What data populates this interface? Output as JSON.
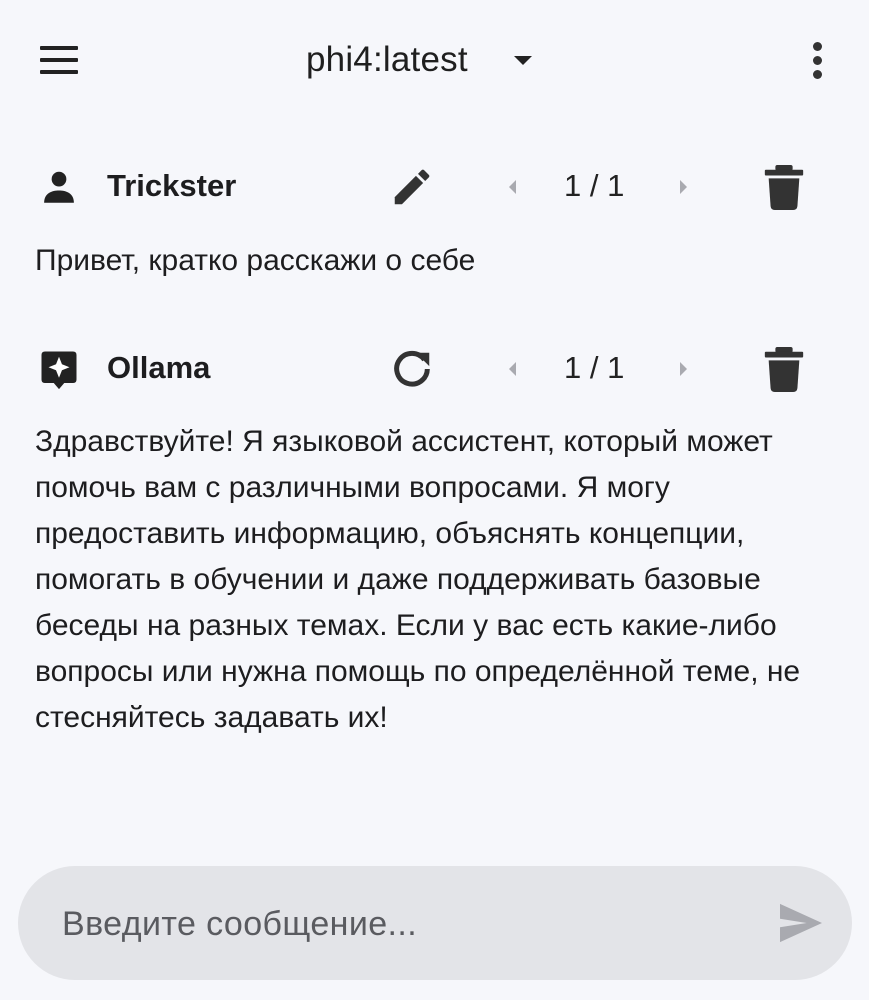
{
  "header": {
    "model_name": "phi4:latest"
  },
  "messages": [
    {
      "author": "Trickster",
      "avatar_icon": "person-icon",
      "action_icon": "edit-pencil-icon",
      "page_counter": "1 / 1",
      "text": "Привет, кратко расскажи о себе"
    },
    {
      "author": "Ollama",
      "avatar_icon": "ollama-sparkle-icon",
      "action_icon": "regenerate-icon",
      "page_counter": "1 / 1",
      "text": "Здравствуйте! Я языковой ассистент, который может помочь вам с различными вопросами. Я могу предоставить информацию, объяснять концепции, помогать в обучении и даже поддерживать базовые беседы на разных темах. Если у вас есть какие-либо вопросы или нужна помощь по определённой теме, не стесняйтесь задавать их!"
    }
  ],
  "composer": {
    "placeholder": "Введите сообщение...",
    "value": ""
  },
  "colors": {
    "background": "#f6f7fb",
    "composer_background": "#e3e4e8",
    "icon": "#333333",
    "disabled_icon": "#a9aab0"
  }
}
